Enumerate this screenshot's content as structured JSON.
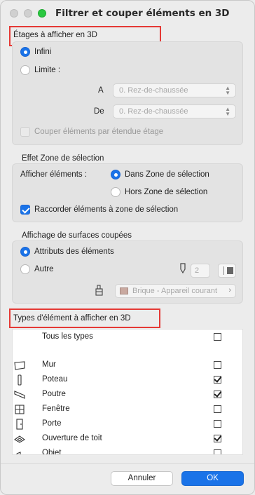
{
  "window": {
    "title": "Filtrer et couper éléments en 3D"
  },
  "floors": {
    "heading": "Étages à afficher en 3D",
    "infinite_label": "Infini",
    "limit_label": "Limite :",
    "from_label": "A",
    "from_value": "0. Rez-de-chaussée",
    "to_label": "De",
    "to_value": "0. Rez-de-chaussée",
    "cut_label": "Couper éléments par étendue étage"
  },
  "selection": {
    "heading": "Effet Zone de sélection",
    "show_label": "Afficher éléments :",
    "inside_label": "Dans Zone de sélection",
    "outside_label": "Hors Zone de sélection",
    "connect_label": "Raccorder éléments à zone de sélection"
  },
  "cut_surfaces": {
    "heading": "Affichage de surfaces coupées",
    "element_attrs_label": "Attributs des éléments",
    "other_label": "Autre",
    "pen_value": "2",
    "material_value": "Brique - Appareil courant"
  },
  "types": {
    "heading": "Types d'élément à afficher en 3D",
    "all_label": "Tous les types",
    "items": [
      {
        "label": "Mur",
        "checked": false,
        "icon": "wall-icon"
      },
      {
        "label": "Poteau",
        "checked": true,
        "icon": "column-icon"
      },
      {
        "label": "Poutre",
        "checked": true,
        "icon": "beam-icon"
      },
      {
        "label": "Fenêtre",
        "checked": false,
        "icon": "window-icon"
      },
      {
        "label": "Porte",
        "checked": false,
        "icon": "door-icon"
      },
      {
        "label": "Ouverture de toit",
        "checked": true,
        "icon": "roof-opening-icon"
      },
      {
        "label": "Objet",
        "checked": false,
        "icon": "object-icon"
      }
    ]
  },
  "buttons": {
    "cancel": "Annuler",
    "ok": "OK"
  },
  "colors": {
    "accent": "#1a73e8",
    "highlight": "#e53935"
  }
}
